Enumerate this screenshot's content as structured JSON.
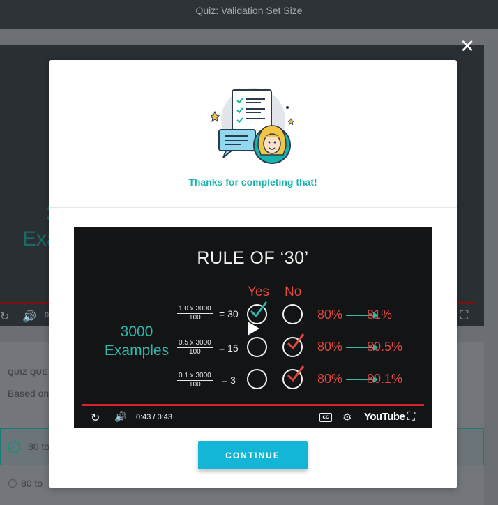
{
  "page": {
    "title": "Quiz: Validation Set Size"
  },
  "background": {
    "slide_text_line1": "3",
    "slide_text_line2": "Exa",
    "time_fragment": "0",
    "quiz_label": "QUIZ QUE",
    "quiz_question": "Based on",
    "option1": "80 to",
    "option2": "80 to"
  },
  "modal": {
    "thanks": "Thanks for completing that!",
    "continue_label": "CONTINUE"
  },
  "video": {
    "title": "RULE OF ‘30’",
    "col_yes": "Yes",
    "col_no": "No",
    "examples_line1": "3000",
    "examples_line2": "Examples",
    "rows": [
      {
        "num": "1.0 x 3000",
        "den": "100",
        "result": "= 30",
        "from": "80%",
        "to": "81%",
        "selected": "yes"
      },
      {
        "num": "0.5 x 3000",
        "den": "100",
        "result": "= 15",
        "from": "80%",
        "to": "80.5%",
        "selected": "no"
      },
      {
        "num": "0.1 x 3000",
        "den": "100",
        "result": "= 3",
        "from": "80%",
        "to": "80.1%",
        "selected": "no"
      }
    ],
    "time": "0:43 / 0:43",
    "brand": "YouTube",
    "colors": {
      "accent": "#33b8a8",
      "red": "#e0473f",
      "progress": "#d7232e"
    }
  },
  "icons": [
    "close-icon",
    "replay-icon",
    "volume-icon",
    "play-icon",
    "cc-icon",
    "settings-hd-icon",
    "fullscreen-icon",
    "check-circle-icon"
  ]
}
